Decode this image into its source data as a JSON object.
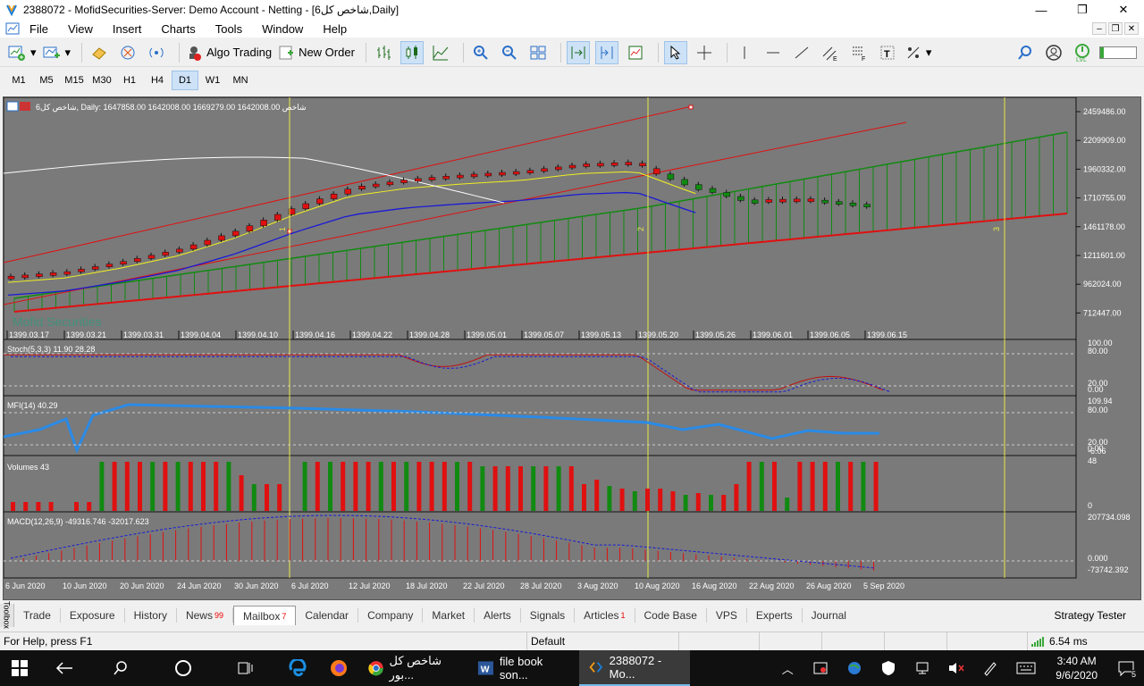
{
  "window": {
    "title": "2388072 - MofidSecurities-Server: Demo Account - Netting - [6شاخص کل,Daily]",
    "min": "—",
    "max": "❐",
    "close": "✕"
  },
  "menu": [
    "File",
    "View",
    "Insert",
    "Charts",
    "Tools",
    "Window",
    "Help"
  ],
  "mdi": [
    "–",
    "❐",
    "✕"
  ],
  "toolbar": {
    "algo_trading": "Algo Trading",
    "new_order": "New Order"
  },
  "timeframes": [
    "M1",
    "M5",
    "M15",
    "M30",
    "H1",
    "H4",
    "D1",
    "W1",
    "MN"
  ],
  "active_timeframe": "D1",
  "chart": {
    "header": "شاخص کل6, Daily:  1647858.00 1642008.00 1669279.00 1642008.00  شاخص",
    "watermark": "Mofid Securities",
    "price_axis": [
      "2459486.00",
      "2209909.00",
      "1960332.00",
      "1710755.00",
      "1461178.00",
      "1211601.00",
      "962024.00",
      "712447.00"
    ],
    "date_axis_top": [
      "1399.03.17",
      "1399.03.21",
      "1399.03.31",
      "1399.04.04",
      "1399.04.10",
      "1399.04.16",
      "1399.04.22",
      "1399.04.28",
      "1399.05.01",
      "1399.05.07",
      "1399.05.13",
      "1399.05.20",
      "1399.05.26",
      "1399.06.01",
      "1399.06.05",
      "1399.06.15"
    ],
    "date_axis_bottom": [
      "6 Jun 2020",
      "10 Jun 2020",
      "20 Jun 2020",
      "24 Jun 2020",
      "30 Jun 2020",
      "6 Jul 2020",
      "12 Jul 2020",
      "18 Jul 2020",
      "22 Jul 2020",
      "28 Jul 2020",
      "3 Aug 2020",
      "10 Aug 2020",
      "16 Aug 2020",
      "22 Aug 2020",
      "26 Aug 2020",
      "5 Sep 2020"
    ],
    "marker_1": "1",
    "marker_2": "2",
    "marker_3": "3",
    "stoch_label": "Stoch(5,3,3) 11.90 28.28",
    "stoch_axis": [
      "100.00",
      "80.00",
      "20.00",
      "0.00"
    ],
    "mfi_label": "MFI(14) 40.29",
    "mfi_axis": [
      "109.94",
      "80.00",
      "20.00",
      "0.00",
      "-6.06"
    ],
    "vol_label": "Volumes 43",
    "vol_axis": [
      "48",
      "0"
    ],
    "macd_label": "MACD(12,26,9) -49316.746 -32017.623",
    "macd_axis": [
      "207734.098",
      "0.000",
      "-73742.392"
    ],
    "colors": {
      "bg": "#7a7a7a",
      "up": "#118a11",
      "down": "#e01010",
      "grid": "#000000",
      "vline": "#e8e84a"
    }
  },
  "chart_data": {
    "type": "candlestick",
    "ylim": [
      712447,
      2459486
    ],
    "x": [
      "1399.03.17",
      "1399.03.21",
      "1399.03.31",
      "1399.04.04",
      "1399.04.10",
      "1399.04.16",
      "1399.04.22",
      "1399.04.28",
      "1399.05.01",
      "1399.05.07",
      "1399.05.13",
      "1399.05.20",
      "1399.05.26",
      "1399.06.01",
      "1399.06.05",
      "1399.06.15"
    ],
    "series": [
      {
        "values": [
          1020000,
          1060000,
          1150000,
          1260000,
          1420000,
          1620000,
          1790000,
          1860000,
          1900000,
          1930000,
          1990000,
          2010000,
          1820000,
          1680000,
          1690000,
          1642008
        ]
      }
    ]
  },
  "bottom_tabs": [
    {
      "label": "Trade"
    },
    {
      "label": "Exposure"
    },
    {
      "label": "History"
    },
    {
      "label": "News",
      "badge": "99"
    },
    {
      "label": "Mailbox",
      "badge": "7"
    },
    {
      "label": "Calendar"
    },
    {
      "label": "Company"
    },
    {
      "label": "Market"
    },
    {
      "label": "Alerts"
    },
    {
      "label": "Signals"
    },
    {
      "label": "Articles",
      "badge": "1"
    },
    {
      "label": "Code Base"
    },
    {
      "label": "VPS"
    },
    {
      "label": "Experts"
    },
    {
      "label": "Journal"
    }
  ],
  "toolbox_label": "Toolbox",
  "strategy_tester": "Strategy Tester",
  "status": {
    "help": "For Help, press F1",
    "profile": "Default",
    "ping": "6.54 ms"
  },
  "taskbar": {
    "chrome_label": "شاخص کل بور...",
    "word_label": "file book son...",
    "mt5_label": "2388072 - Mo...",
    "time": "3:40 AM",
    "date": "9/6/2020",
    "notif": "5"
  }
}
